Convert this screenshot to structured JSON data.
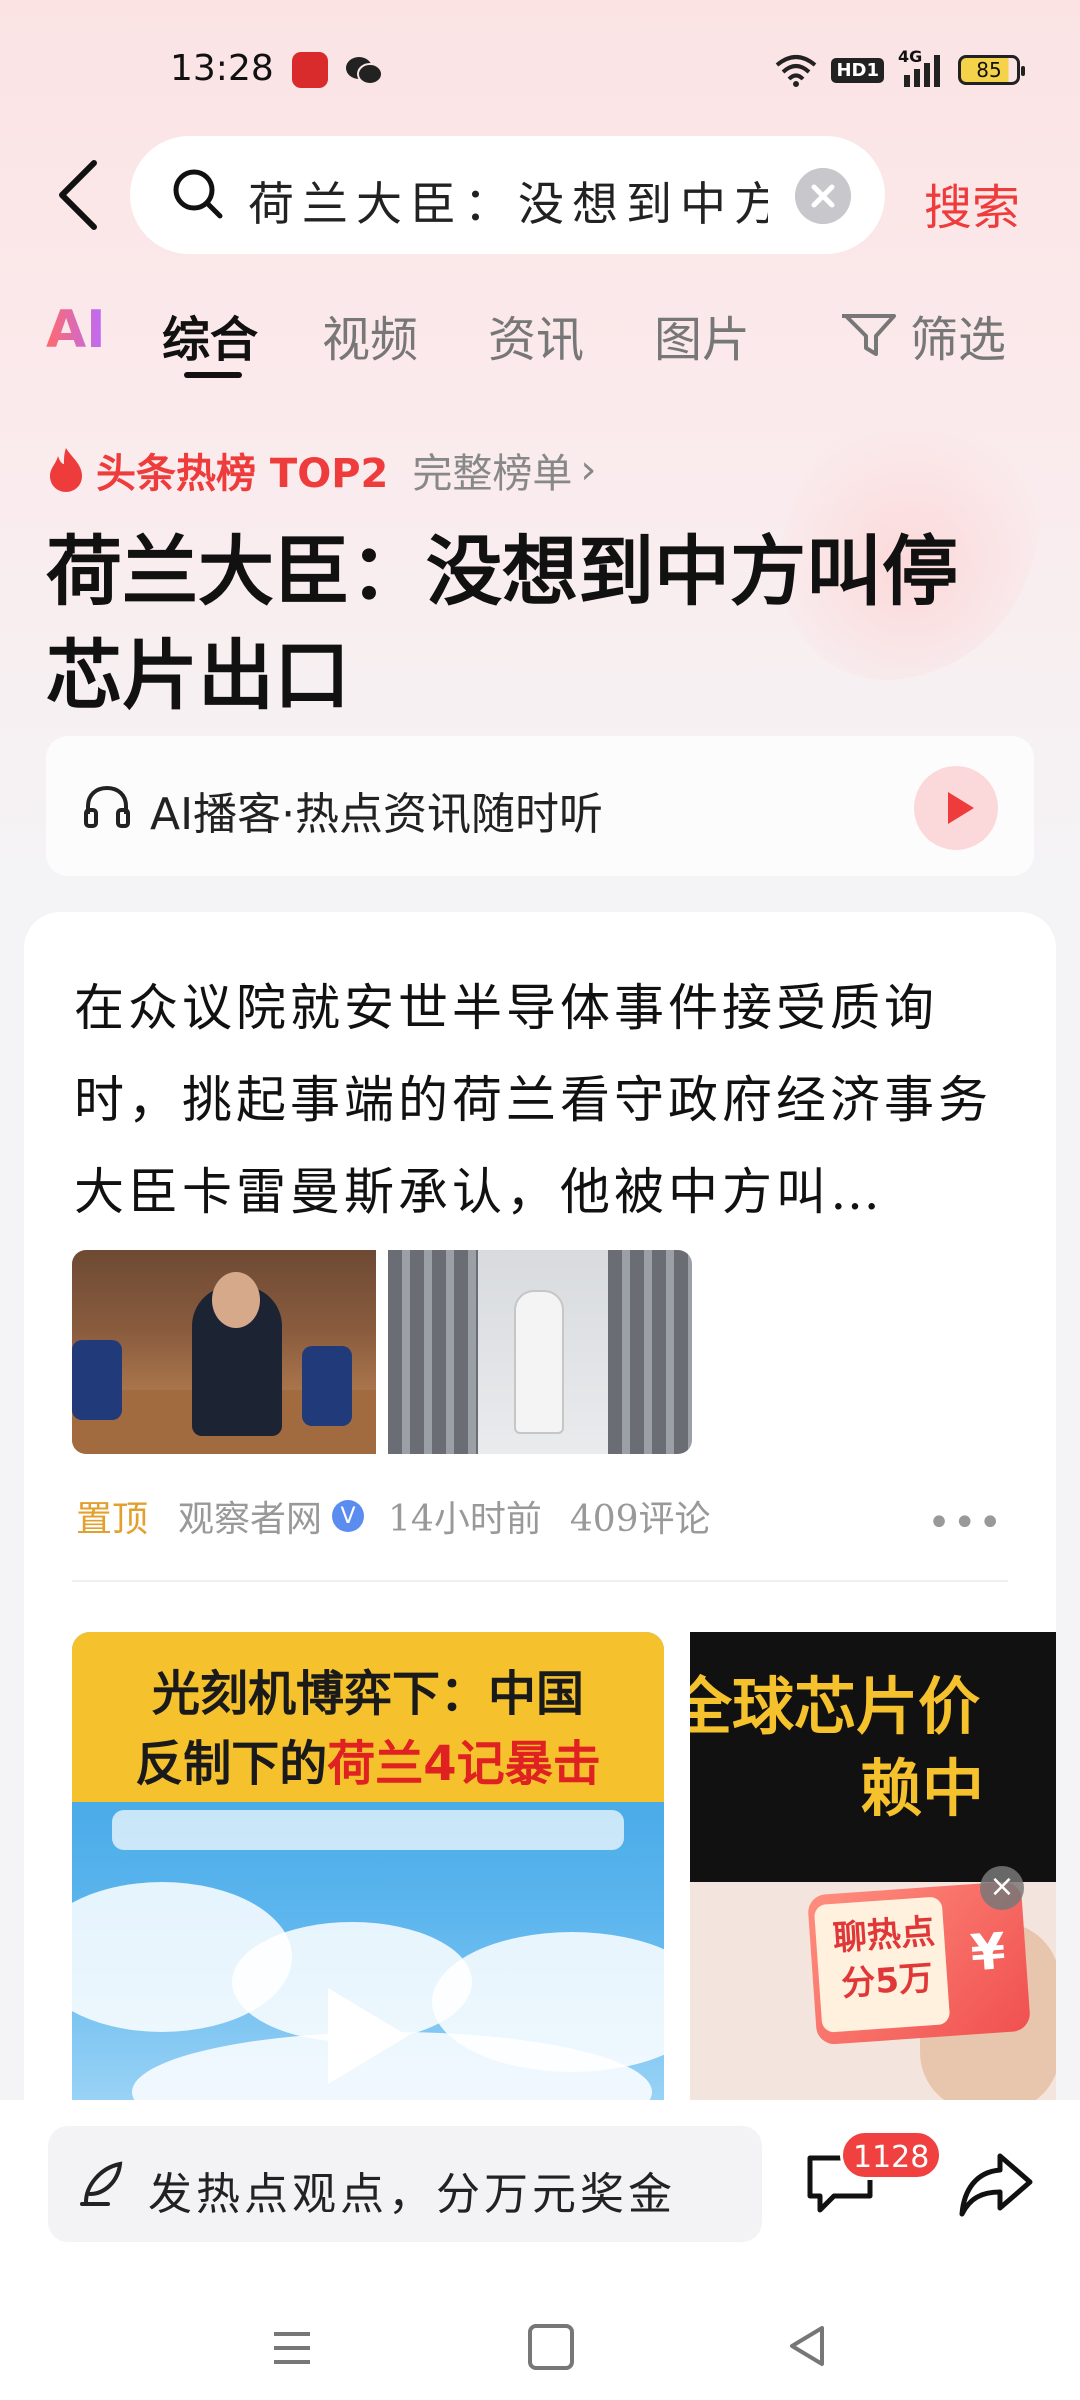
{
  "status_bar": {
    "time": "13:28",
    "network": "4G",
    "hd": "HD1",
    "battery": "85"
  },
  "search": {
    "query": "荷兰大臣：没想到中方",
    "button": "搜索"
  },
  "tabs": {
    "ai": "AI",
    "items": [
      "综合",
      "视频",
      "资讯",
      "图片"
    ],
    "filter": "筛选"
  },
  "hot_rank": {
    "label": "头条热榜 TOP2",
    "full_list": "完整榜单"
  },
  "headline": "荷兰大臣：没想到中方叫停芯片出口",
  "podcast": {
    "label": "AI播客·热点资讯随时听"
  },
  "article": {
    "text": "在众议院就安世半导体事件接受质询时，挑起事端的荷兰看守政府经济事务大臣卡雷曼斯承认，他被中方叫…",
    "pinned": "置顶",
    "source": "观察者网",
    "verified": "V",
    "time": "14小时前",
    "comments": "409评论"
  },
  "video1": {
    "title_line1": "光刻机博弈下：中国",
    "title_line2_a": "反制下的",
    "title_line2_b": "荷兰4记暴击"
  },
  "video2": {
    "title_line1": "全球芯片价",
    "title_line2": "赖中"
  },
  "red_packet": {
    "text": "聊热点分5万",
    "symbol": "¥"
  },
  "bottom": {
    "comment_placeholder": "发热点观点，分万元奖金",
    "comment_count": "1128"
  },
  "colors": {
    "accent": "#ee3c3c",
    "pin": "#e2a12e",
    "badge": "#f0403f"
  }
}
